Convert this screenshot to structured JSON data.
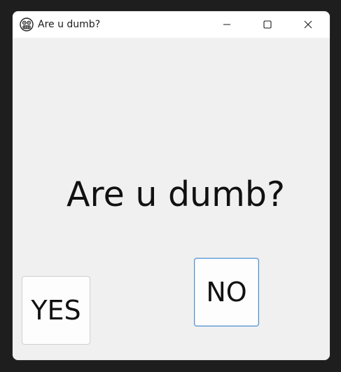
{
  "window": {
    "title": "Are u dumb?",
    "app_icon": "grimace-emoji-icon"
  },
  "caption_buttons": {
    "minimize_icon": "minimize-icon",
    "maximize_icon": "maximize-icon",
    "close_icon": "close-icon"
  },
  "content": {
    "question": "Are u dumb?",
    "yes_label": "YES",
    "no_label": "NO"
  },
  "colors": {
    "titlebar_bg": "#ffffff",
    "client_bg": "#f0f0f0",
    "focus_border": "#4a90d0"
  }
}
